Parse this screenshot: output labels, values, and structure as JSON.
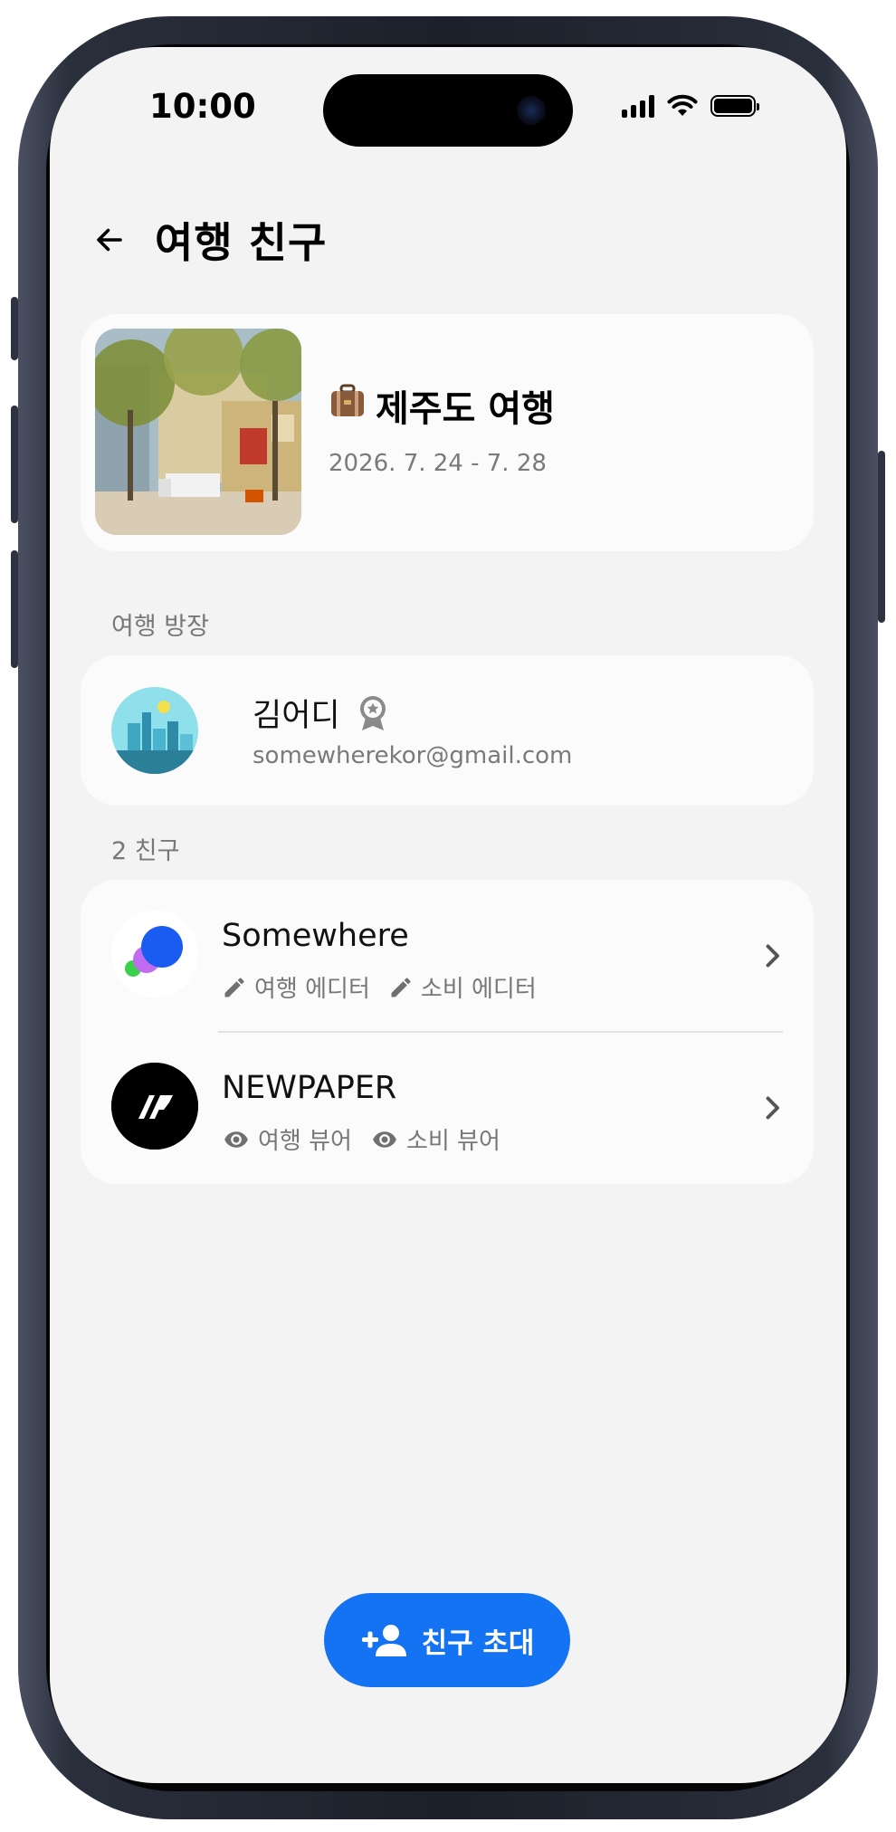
{
  "status_bar": {
    "time": "10:00"
  },
  "header": {
    "title": "여행 친구"
  },
  "trip": {
    "emoji": "💼",
    "name": "제주도 여행",
    "dates": "2026. 7. 24 - 7. 28"
  },
  "owner_section": {
    "label": "여행 방장",
    "owner": {
      "name": "김어디",
      "email": "somewherekor@gmail.com",
      "badge_icon": "award-icon"
    }
  },
  "friends_section": {
    "label": "2 친구",
    "friends": [
      {
        "name": "Somewhere",
        "roles": [
          "여행 에디터",
          "소비 에디터"
        ],
        "role_icon": "pencil-icon"
      },
      {
        "name": "NEWPAPER",
        "roles": [
          "여행 뷰어",
          "소비 뷰어"
        ],
        "role_icon": "eye-icon"
      }
    ]
  },
  "invite_button": {
    "label": "친구 초대"
  },
  "colors": {
    "accent": "#1473F2",
    "background": "#F3F3F3",
    "card": "#FBFBFB"
  }
}
